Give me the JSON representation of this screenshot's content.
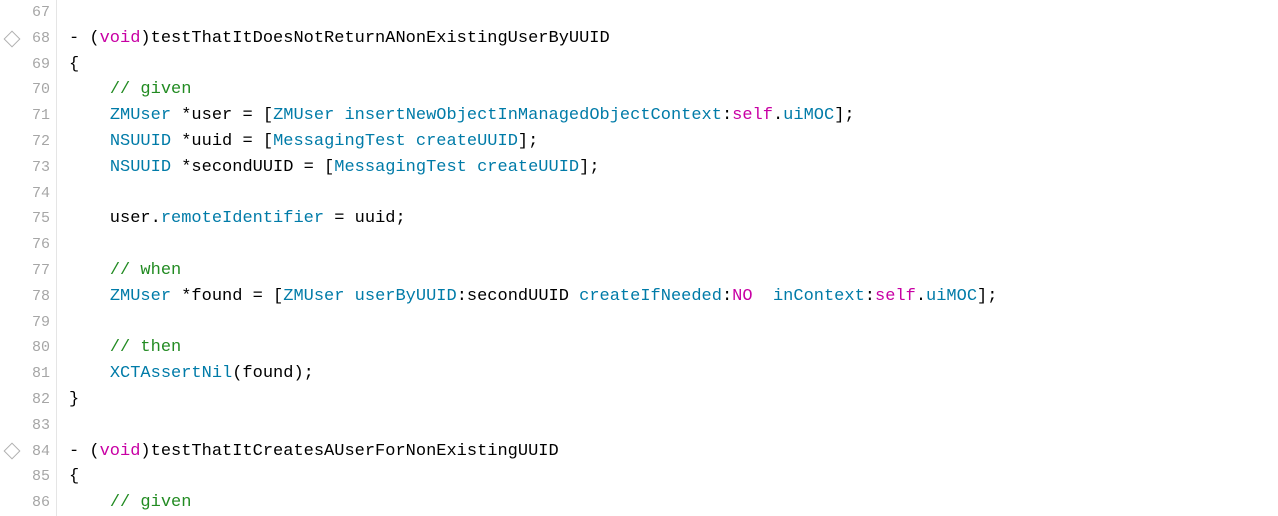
{
  "lines": [
    {
      "num": 67,
      "diamond": false,
      "spans": []
    },
    {
      "num": 68,
      "diamond": true,
      "spans": [
        {
          "cls": "plain",
          "t": "- ("
        },
        {
          "cls": "kw-void",
          "t": "void"
        },
        {
          "cls": "plain",
          "t": ")testThatItDoesNotReturnANonExistingUserByUUID"
        }
      ]
    },
    {
      "num": 69,
      "diamond": false,
      "spans": [
        {
          "cls": "plain",
          "t": "{"
        }
      ]
    },
    {
      "num": 70,
      "diamond": false,
      "spans": [
        {
          "cls": "plain",
          "t": "    "
        },
        {
          "cls": "comment",
          "t": "// given"
        }
      ]
    },
    {
      "num": 71,
      "diamond": false,
      "spans": [
        {
          "cls": "plain",
          "t": "    "
        },
        {
          "cls": "type",
          "t": "ZMUser"
        },
        {
          "cls": "plain",
          "t": " *user = ["
        },
        {
          "cls": "type",
          "t": "ZMUser"
        },
        {
          "cls": "plain",
          "t": " "
        },
        {
          "cls": "method",
          "t": "insertNewObjectInManagedObjectContext"
        },
        {
          "cls": "plain",
          "t": ":"
        },
        {
          "cls": "kw-self",
          "t": "self"
        },
        {
          "cls": "plain",
          "t": "."
        },
        {
          "cls": "prop",
          "t": "uiMOC"
        },
        {
          "cls": "plain",
          "t": "];"
        }
      ]
    },
    {
      "num": 72,
      "diamond": false,
      "spans": [
        {
          "cls": "plain",
          "t": "    "
        },
        {
          "cls": "type",
          "t": "NSUUID"
        },
        {
          "cls": "plain",
          "t": " *uuid = ["
        },
        {
          "cls": "type",
          "t": "MessagingTest"
        },
        {
          "cls": "plain",
          "t": " "
        },
        {
          "cls": "method",
          "t": "createUUID"
        },
        {
          "cls": "plain",
          "t": "];"
        }
      ]
    },
    {
      "num": 73,
      "diamond": false,
      "spans": [
        {
          "cls": "plain",
          "t": "    "
        },
        {
          "cls": "type",
          "t": "NSUUID"
        },
        {
          "cls": "plain",
          "t": " *secondUUID = ["
        },
        {
          "cls": "type",
          "t": "MessagingTest"
        },
        {
          "cls": "plain",
          "t": " "
        },
        {
          "cls": "method",
          "t": "createUUID"
        },
        {
          "cls": "plain",
          "t": "];"
        }
      ]
    },
    {
      "num": 74,
      "diamond": false,
      "spans": []
    },
    {
      "num": 75,
      "diamond": false,
      "spans": [
        {
          "cls": "plain",
          "t": "    user."
        },
        {
          "cls": "prop",
          "t": "remoteIdentifier"
        },
        {
          "cls": "plain",
          "t": " = uuid;"
        }
      ]
    },
    {
      "num": 76,
      "diamond": false,
      "spans": []
    },
    {
      "num": 77,
      "diamond": false,
      "spans": [
        {
          "cls": "plain",
          "t": "    "
        },
        {
          "cls": "comment",
          "t": "// when"
        }
      ]
    },
    {
      "num": 78,
      "diamond": false,
      "spans": [
        {
          "cls": "plain",
          "t": "    "
        },
        {
          "cls": "type",
          "t": "ZMUser"
        },
        {
          "cls": "plain",
          "t": " *found = ["
        },
        {
          "cls": "type",
          "t": "ZMUser"
        },
        {
          "cls": "plain",
          "t": " "
        },
        {
          "cls": "method",
          "t": "userByUUID"
        },
        {
          "cls": "plain",
          "t": ":secondUUID "
        },
        {
          "cls": "method",
          "t": "createIfNeeded"
        },
        {
          "cls": "plain",
          "t": ":"
        },
        {
          "cls": "const",
          "t": "NO"
        },
        {
          "cls": "plain",
          "t": "  "
        },
        {
          "cls": "method",
          "t": "inContext"
        },
        {
          "cls": "plain",
          "t": ":"
        },
        {
          "cls": "kw-self",
          "t": "self"
        },
        {
          "cls": "plain",
          "t": "."
        },
        {
          "cls": "prop",
          "t": "uiMOC"
        },
        {
          "cls": "plain",
          "t": "];"
        }
      ]
    },
    {
      "num": 79,
      "diamond": false,
      "spans": []
    },
    {
      "num": 80,
      "diamond": false,
      "spans": [
        {
          "cls": "plain",
          "t": "    "
        },
        {
          "cls": "comment",
          "t": "// then"
        }
      ]
    },
    {
      "num": 81,
      "diamond": false,
      "spans": [
        {
          "cls": "plain",
          "t": "    "
        },
        {
          "cls": "type",
          "t": "XCTAssertNil"
        },
        {
          "cls": "plain",
          "t": "(found);"
        }
      ]
    },
    {
      "num": 82,
      "diamond": false,
      "spans": [
        {
          "cls": "plain",
          "t": "}"
        }
      ]
    },
    {
      "num": 83,
      "diamond": false,
      "spans": []
    },
    {
      "num": 84,
      "diamond": true,
      "spans": [
        {
          "cls": "plain",
          "t": "- ("
        },
        {
          "cls": "kw-void",
          "t": "void"
        },
        {
          "cls": "plain",
          "t": ")testThatItCreatesAUserForNonExistingUUID"
        }
      ]
    },
    {
      "num": 85,
      "diamond": false,
      "spans": [
        {
          "cls": "plain",
          "t": "{"
        }
      ]
    },
    {
      "num": 86,
      "diamond": false,
      "spans": [
        {
          "cls": "plain",
          "t": "    "
        },
        {
          "cls": "comment",
          "t": "// given"
        }
      ]
    }
  ]
}
